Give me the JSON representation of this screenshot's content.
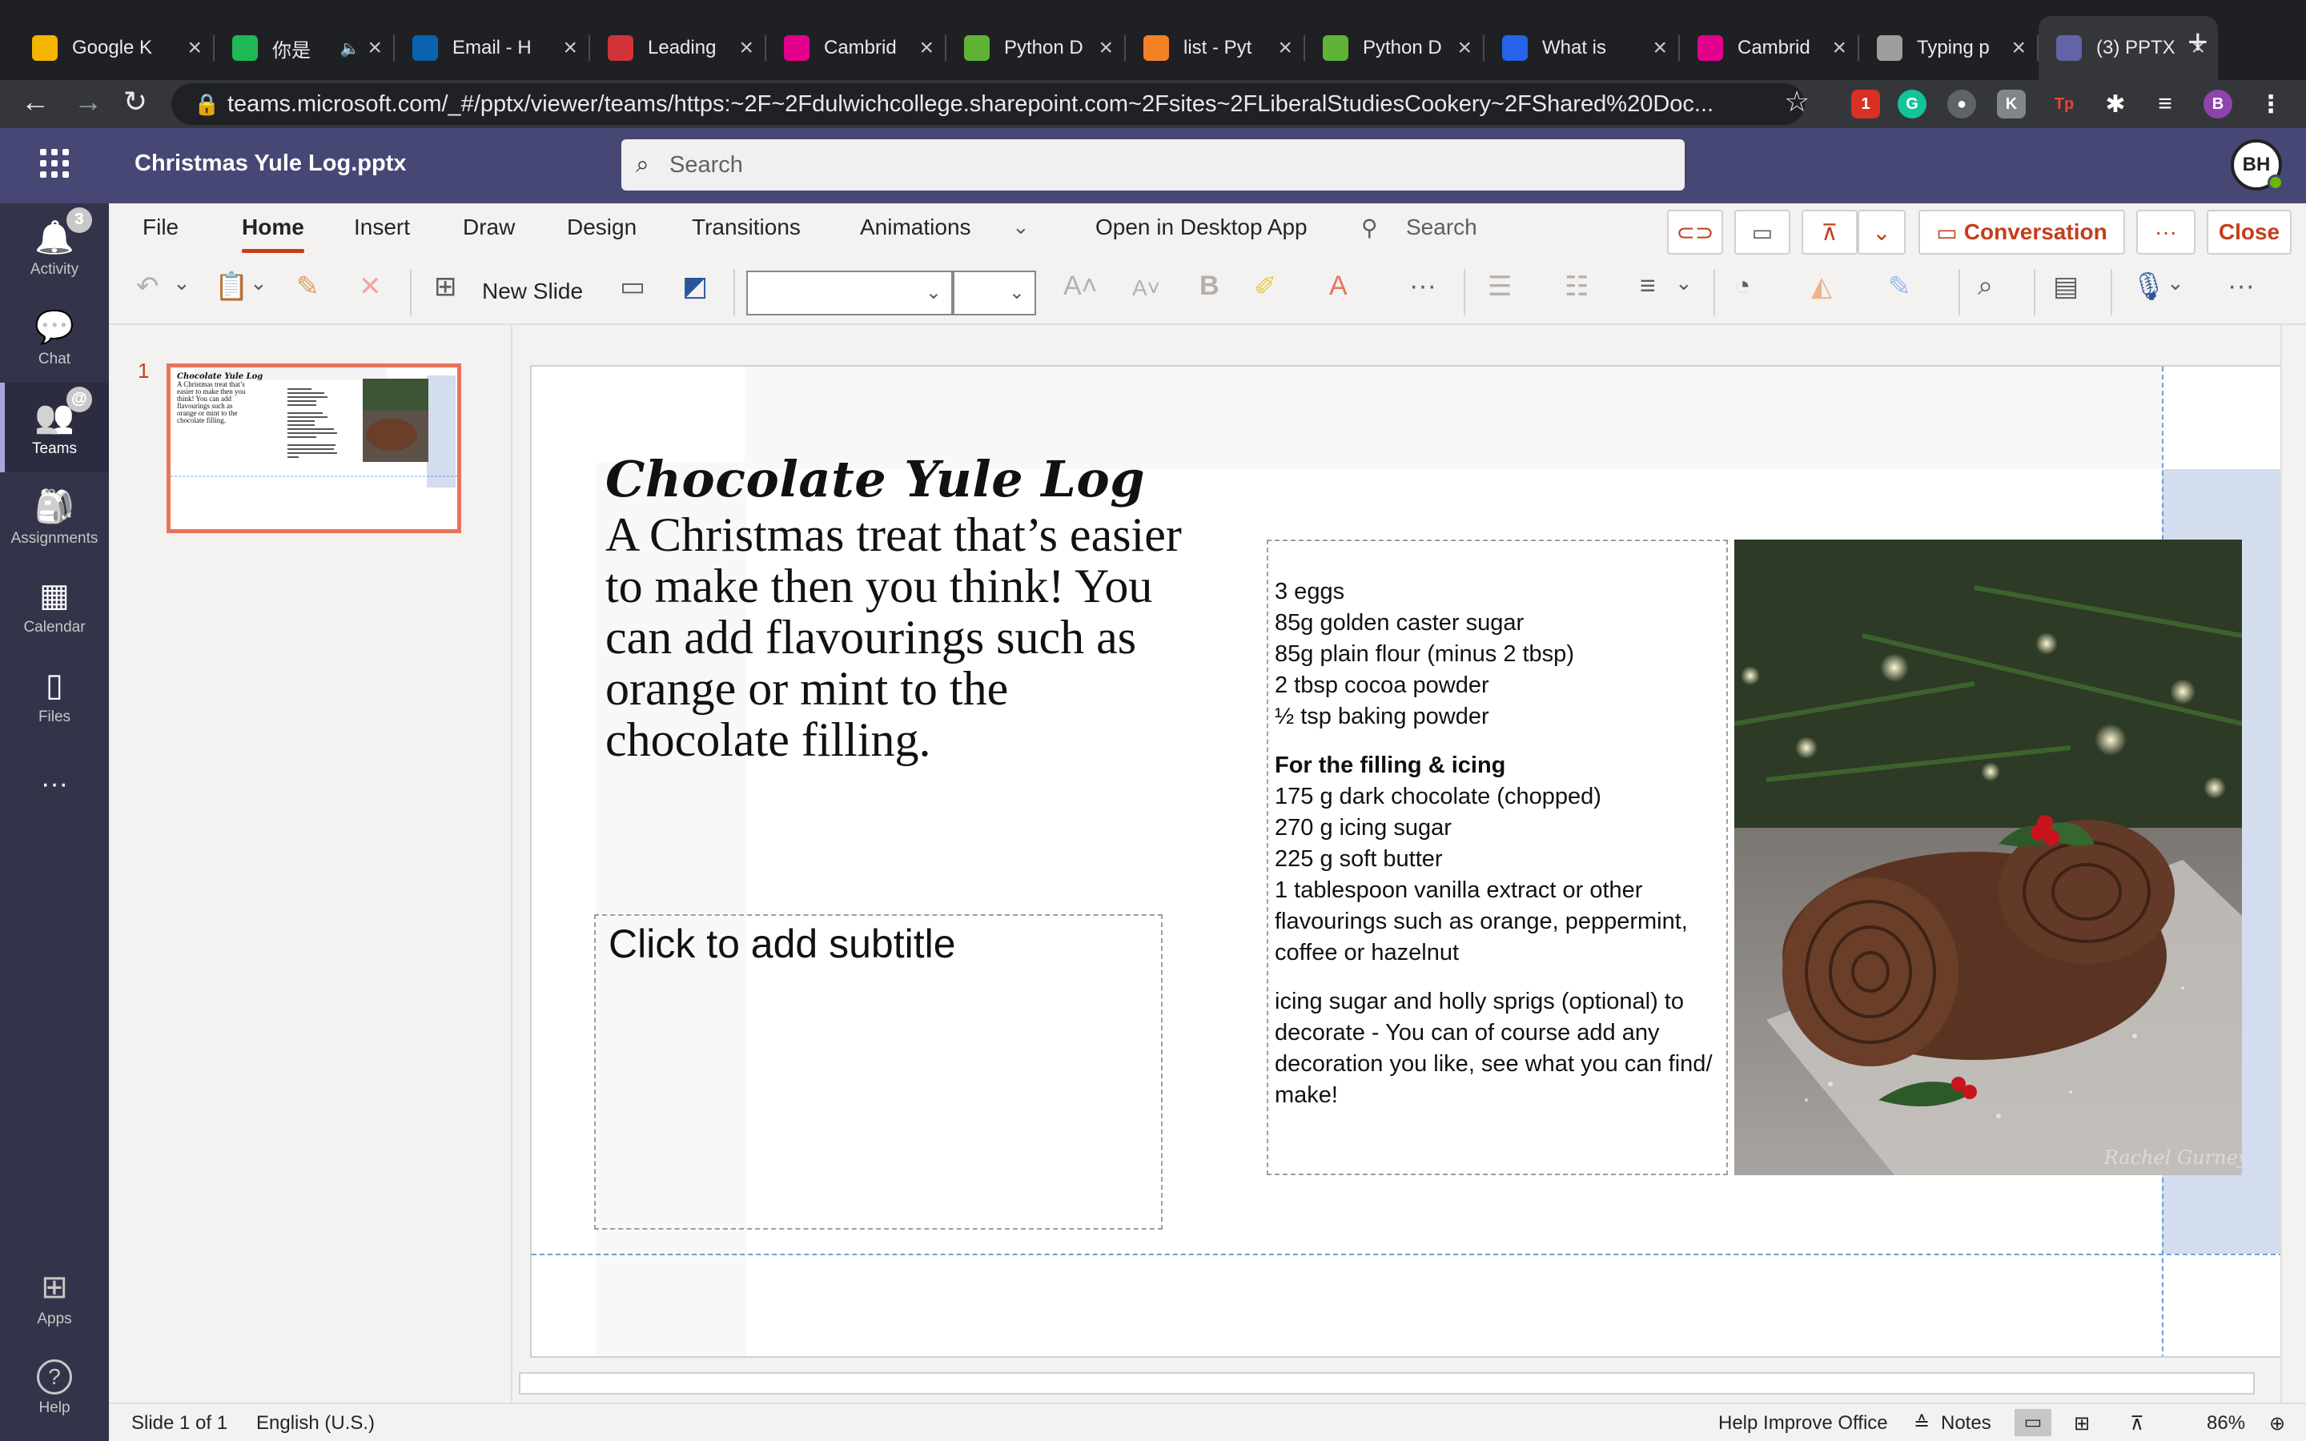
{
  "browser": {
    "tabs": [
      {
        "label": "Google K",
        "favicon": "keep-icon",
        "color": "#f4b400"
      },
      {
        "label": "你是",
        "favicon": "spotify-icon",
        "color": "#1db954",
        "audio": true
      },
      {
        "label": "Email - H",
        "favicon": "outlook-icon",
        "color": "#0a64ad"
      },
      {
        "label": "Leading",
        "favicon": "app-icon",
        "color": "#d13438"
      },
      {
        "label": "Cambrid",
        "favicon": "cambridge-icon",
        "color": "#e3008c"
      },
      {
        "label": "Python D",
        "favicon": "w3-icon",
        "color": "#5fb336"
      },
      {
        "label": "list - Pyt",
        "favicon": "stackoverflow-icon",
        "color": "#f48024"
      },
      {
        "label": "Python D",
        "favicon": "w3-icon",
        "color": "#5fb336"
      },
      {
        "label": "What is",
        "favicon": "app-icon",
        "color": "#2563eb"
      },
      {
        "label": "Cambrid",
        "favicon": "cambridge-icon",
        "color": "#e3008c"
      },
      {
        "label": "Typing p",
        "favicon": "page-icon",
        "color": "#9e9e9e"
      },
      {
        "label": "(3) PPTX",
        "favicon": "teams-icon",
        "color": "#6264a7",
        "active": true
      }
    ],
    "url": "teams.microsoft.com/_#/pptx/viewer/teams/https:~2F~2Fdulwichcollege.sharepoint.com~2Fsites~2FLiberalStudiesCookery~2FShared%20Doc...",
    "extension_badge": "1",
    "profile_initial": "B"
  },
  "teams": {
    "doc_title": "Christmas Yule Log.pptx",
    "search_placeholder": "Search",
    "avatar_initials": "BH",
    "apps": [
      {
        "label": "Activity",
        "icon": "bell-icon",
        "badge": "3"
      },
      {
        "label": "Chat",
        "icon": "chat-icon"
      },
      {
        "label": "Teams",
        "icon": "teams-icon",
        "badge": "@",
        "active": true
      },
      {
        "label": "Assignments",
        "icon": "assignments-icon"
      },
      {
        "label": "Calendar",
        "icon": "calendar-icon"
      },
      {
        "label": "Files",
        "icon": "files-icon"
      },
      {
        "label": "...",
        "icon": "more-icon"
      }
    ],
    "bottom_apps": [
      {
        "label": "Apps",
        "icon": "apps-icon"
      },
      {
        "label": "Help",
        "icon": "help-icon"
      }
    ]
  },
  "ribbon": {
    "tabs": [
      "File",
      "Home",
      "Insert",
      "Draw",
      "Design",
      "Transitions",
      "Animations"
    ],
    "active_tab": "Home",
    "open_desktop": "Open in Desktop App",
    "search": "Search",
    "conversation": "Conversation",
    "more": "···",
    "close": "Close",
    "new_slide": "New Slide"
  },
  "slide": {
    "number": "1",
    "title": "Chocolate Yule Log",
    "body": "A Christmas treat that’s easier to make then you think! You can add flavourings such as orange or mint to the chocolate filling.",
    "subtitle_placeholder": "Click to add subtitle",
    "ingredients": [
      "3 eggs",
      "85g golden caster sugar",
      "85g plain flour (minus 2 tbsp)",
      "2 tbsp cocoa powder",
      "½ tsp baking powder"
    ],
    "filling_heading": "For the filling & icing",
    "filling": [
      "175 g dark chocolate (chopped)",
      "270 g icing sugar",
      "225 g soft butter",
      "1 tablespoon vanilla extract or other",
      "flavourings such as orange, peppermint,",
      "coffee or hazelnut"
    ],
    "decoration": [
      "icing sugar and holly sprigs (optional) to",
      "decorate - You can of course add any",
      "decoration you like, see what you can find/",
      "make!"
    ],
    "photo_credit": "Rachel Gurney"
  },
  "status": {
    "slide_of": "Slide 1 of 1",
    "language": "English (U.S.)",
    "help": "Help Improve Office",
    "notes": "Notes",
    "zoom": "86%"
  }
}
